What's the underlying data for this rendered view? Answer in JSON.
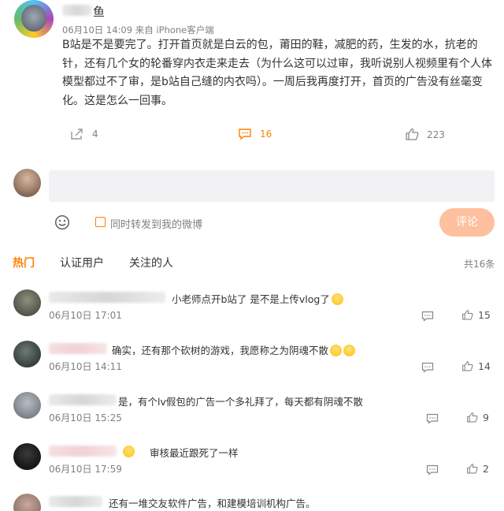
{
  "post": {
    "username_tail": "鱼",
    "meta": "06月10日 14:09  来自 iPhone客户端",
    "text": "B站是不是要完了。打开首页就是白云的包，莆田的鞋，减肥的药，生发的水，抗老的针，还有几个女的轮番穿内衣走来走去（为什么这可以过审，我听说别人视频里有个人体模型都过不了审，是b站自己缝的内衣吗）。一周后我再度打开，首页的广告没有丝毫变化。这是怎么一回事。",
    "repost_count": "4",
    "comment_count": "16",
    "like_count": "223"
  },
  "composer": {
    "repost_label": "同时转发到我的微博",
    "submit_label": "评论"
  },
  "tabs": [
    {
      "label": "热门",
      "active": true
    },
    {
      "label": "认证用户",
      "active": false
    },
    {
      "label": "关注的人",
      "active": false
    }
  ],
  "total_label": "共16条",
  "replies": [
    {
      "text": "小老师点开b站了 是不是上传vlog了",
      "emoji_count": 1,
      "date": "06月10日 17:01",
      "likes": "15"
    },
    {
      "text": "确实，还有那个砍树的游戏，我愿称之为阴魂不散",
      "emoji_count": 2,
      "date": "06月10日 14:11",
      "likes": "14"
    },
    {
      "text": "是，有个lv假包的广告一个多礼拜了，每天都有阴魂不散",
      "emoji_count": 0,
      "date": "06月10日 15:25",
      "likes": "9"
    },
    {
      "text": "审核最近跟死了一样",
      "emoji_count": 0,
      "date": "06月10日 17:59",
      "likes": "2"
    },
    {
      "text": "还有一堆交友软件广告，和建模培训机构广告。",
      "emoji_count": 0,
      "date": "",
      "likes": ""
    }
  ],
  "colors": {
    "accent": "#ff8200",
    "submit_bg": "#ffc09f",
    "input_bg": "#f2f2f5",
    "muted_text": "#808080"
  }
}
